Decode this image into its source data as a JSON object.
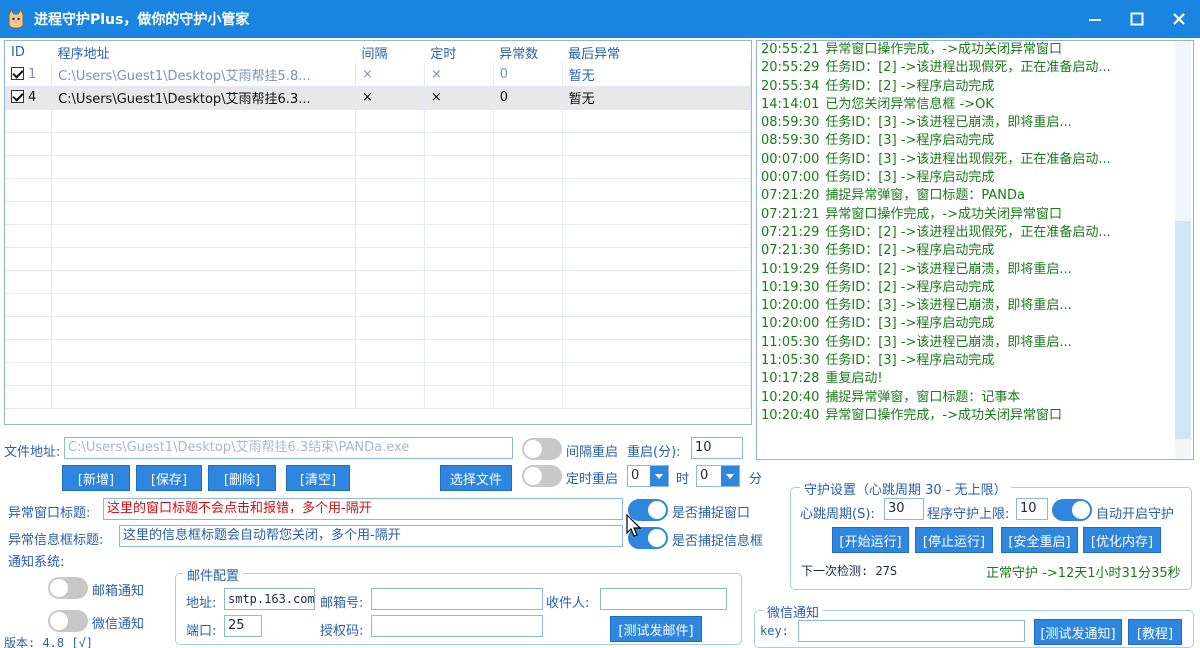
{
  "window": {
    "title": "进程守护Plus，做你的守护小管家"
  },
  "table": {
    "headers": [
      "ID",
      "程序地址",
      "间隔",
      "定时",
      "异常数",
      "最后异常"
    ],
    "rows": [
      {
        "id": "1",
        "path": "C:\\Users\\Guest1\\Desktop\\艾雨帮挂5.8...",
        "interval": "×",
        "timer": "×",
        "count": "0",
        "last": "暂无"
      },
      {
        "id": "4",
        "path": "C:\\Users\\Guest1\\Desktop\\艾雨帮挂6.3...",
        "interval": "×",
        "timer": "×",
        "count": "0",
        "last": "暂无"
      }
    ]
  },
  "log": [
    {
      "time": "20:55:21",
      "msg": "异常窗口操作完成，->成功关闭异常窗口"
    },
    {
      "time": "20:55:29",
      "msg": "任务ID：[2] ->该进程出现假死，正在准备启动..."
    },
    {
      "time": "20:55:34",
      "msg": "任务ID：[2] ->程序启动完成"
    },
    {
      "time": "14:14:01",
      "msg": "已为您关闭异常信息框 ->OK"
    },
    {
      "time": "08:59:30",
      "msg": "任务ID：[3] ->该进程已崩溃，即将重启..."
    },
    {
      "time": "08:59:30",
      "msg": "任务ID：[3] ->程序启动完成"
    },
    {
      "time": "00:07:00",
      "msg": "任务ID：[3] ->该进程出现假死，正在准备启动..."
    },
    {
      "time": "00:07:00",
      "msg": "任务ID：[3] ->程序启动完成"
    },
    {
      "time": "07:21:20",
      "msg": "捕捉异常弹窗，窗口标题：PANDa"
    },
    {
      "time": "07:21:21",
      "msg": "异常窗口操作完成，->成功关闭异常窗口"
    },
    {
      "time": "07:21:29",
      "msg": "任务ID：[2] ->该进程出现假死，正在准备启动..."
    },
    {
      "time": "07:21:30",
      "msg": "任务ID：[2] ->程序启动完成"
    },
    {
      "time": "10:19:29",
      "msg": "任务ID：[2] ->该进程已崩溃，即将重启..."
    },
    {
      "time": "10:19:30",
      "msg": "任务ID：[2] ->程序启动完成"
    },
    {
      "time": "10:20:00",
      "msg": "任务ID：[3] ->该进程已崩溃，即将重启..."
    },
    {
      "time": "10:20:00",
      "msg": "任务ID：[3] ->程序启动完成"
    },
    {
      "time": "11:05:30",
      "msg": "任务ID：[3] ->该进程已崩溃，即将重启..."
    },
    {
      "time": "11:05:30",
      "msg": "任务ID：[3] ->程序启动完成"
    },
    {
      "time": "10:17:28",
      "msg": "重复启动!"
    },
    {
      "time": "10:20:40",
      "msg": "捕捉异常弹窗，窗口标题：记事本"
    },
    {
      "time": "10:20:40",
      "msg": "异常窗口操作完成，->成功关闭异常窗口"
    }
  ],
  "file": {
    "label": "文件地址:",
    "value": "C:\\Users\\Guest1\\Desktop\\艾雨帮挂6.3结束\\PANDa.exe",
    "add": "[新增]",
    "save": "[保存]",
    "delete": "[删除]",
    "clear": "[清空]",
    "choose": "选择文件"
  },
  "interval": {
    "label": "间隔重启",
    "restart_label": "重启(分):",
    "restart_value": "10"
  },
  "timer": {
    "label": "定时重启",
    "hour_value": "0",
    "hour_label": "时",
    "min_value": "0",
    "min_label": "分"
  },
  "abnormal": {
    "window_label": "异常窗口标题:",
    "window_value": "这里的窗口标题不会点击和报错，多个用-隔开",
    "window_toggle": "是否捕捉窗口",
    "info_label": "异常信息框标题:",
    "info_value": "这里的信息框标题会自动帮您关闭，多个用-隔开",
    "info_toggle": "是否捕捉信息框"
  },
  "notify": {
    "label": "通知系统:",
    "email_toggle": "邮箱通知",
    "wechat_toggle": "微信通知"
  },
  "mail": {
    "title": "邮件配置",
    "addr_label": "地址:",
    "addr_value": "smtp.163.com",
    "account_label": "邮箱号:",
    "account_value": "",
    "receiver_label": "收件人:",
    "receiver_value": "",
    "port_label": "端口:",
    "port_value": "25",
    "auth_label": "授权码:",
    "auth_value": "",
    "test_button": "[测试发邮件]"
  },
  "guard": {
    "title": "守护设置（心跳周期 30 - 无上限）",
    "heartbeat_label": "心跳周期(S):",
    "heartbeat_value": "30",
    "limit_label": "程序守护上限:",
    "limit_value": "10",
    "auto_label": "自动开启守护",
    "start": "[开始运行]",
    "stop": "[停止运行]",
    "safe_restart": "[安全重启]",
    "optimize": "[优化内存]",
    "next_check": "下一次检测: 27S",
    "status": "正常守护 ->12天1小时31分35秒"
  },
  "wechat": {
    "title": "微信通知",
    "key_label": "key:",
    "key_value": "",
    "test_button": "[测试发通知]",
    "tutorial": "[教程]"
  },
  "version": "版本: 4.8 [√]",
  "colors": {
    "titlebar": "#1a85e0",
    "accent": "#2e86de",
    "log_green": "#1a7a1a",
    "label_blue": "#2a5fa8",
    "warn_red": "#d01010"
  }
}
